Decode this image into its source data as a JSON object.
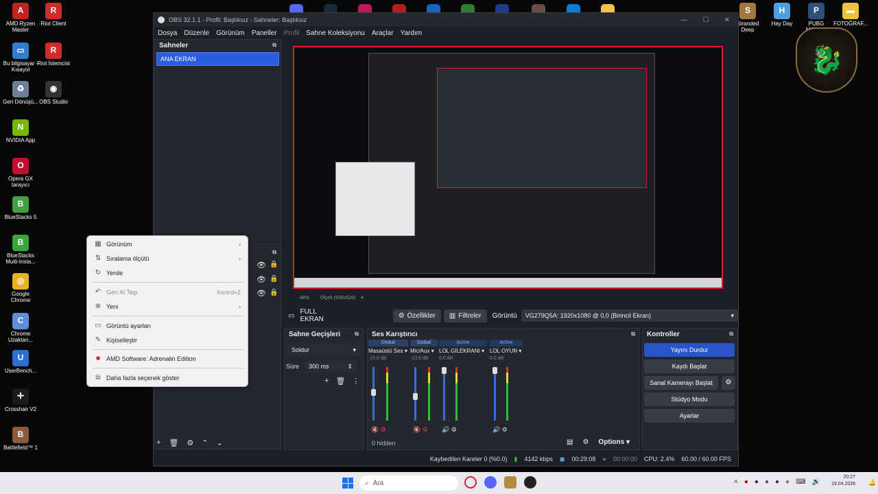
{
  "desktop": {
    "left_icons": [
      {
        "label": "AMD Ryzen Master",
        "color": "#c0241e",
        "glyph": "A"
      },
      {
        "label": "Riot Client",
        "color": "#d32a2a",
        "glyph": "R"
      },
      {
        "label": "Bu bilgisayar - Kısayol",
        "color": "#2f7dd1",
        "glyph": "▭"
      },
      {
        "label": "Riot İstemcisi",
        "color": "#d32a2a",
        "glyph": "R"
      },
      {
        "label": "Geri Dönüşü...",
        "color": "#6c7f96",
        "glyph": "♻"
      },
      {
        "label": "OBS Studio",
        "color": "#333",
        "glyph": "◉"
      },
      {
        "label": "NVIDIA App",
        "color": "#76b900",
        "glyph": "N"
      },
      {
        "label": "Opera GX tarayıcı",
        "color": "#c0102d",
        "glyph": "O"
      },
      {
        "label": "BlueStacks 5",
        "color": "#44a142",
        "glyph": "B"
      },
      {
        "label": "BlueStacks Multi-Insta...",
        "color": "#3aa53a",
        "glyph": "B"
      },
      {
        "label": "Google Chrome",
        "color": "#e8b321",
        "glyph": "◎"
      },
      {
        "label": "Chrome Uzaktan...",
        "color": "#5f8fd6",
        "glyph": "C"
      },
      {
        "label": "UserBench...",
        "color": "#2b6fd1",
        "glyph": "U"
      },
      {
        "label": "Crosshair V2",
        "color": "#1b1b1b",
        "glyph": "✛"
      },
      {
        "label": "Battlefield™ 1",
        "color": "#8d5a3c",
        "glyph": "B"
      }
    ],
    "right_icons": [
      {
        "label": "Stranded Deep",
        "color": "#a17840",
        "glyph": "S"
      },
      {
        "label": "Hay Day",
        "color": "#4aa0e0",
        "glyph": "H"
      },
      {
        "label": "PUBG MOBILE",
        "color": "#2f4f7a",
        "glyph": "P"
      },
      {
        "label": "FOTOĞRAF...",
        "color": "#f0c040",
        "glyph": "▬"
      }
    ],
    "msi_logo": "dragon"
  },
  "obs": {
    "title": "OBS 32.1.1 - Profil: Başlıksız - Sahneler: Başlıksız",
    "menu": [
      "Dosya",
      "Düzenle",
      "Görünüm",
      "Paneller",
      "Profil",
      "Sahne Koleksiyonu",
      "Araçlar",
      "Yardım"
    ],
    "scenes_title": "Sahneler",
    "scenes": [
      "ANA EKRAN"
    ],
    "preview_zoom": "48%",
    "preview_scale": "Ölçek (939x528)",
    "source_name": "FULL EKRAN",
    "properties_label": "Özellikler",
    "filters_label": "Filtreler",
    "display_label": "Görüntü",
    "display_value": "VG279Q5A: 1920x1080 @ 0,0 (Birincil Ekran)",
    "transitions": {
      "title": "Sahne Geçişleri",
      "value": "Soldur",
      "duration_label": "Süre",
      "duration": "300 ms"
    },
    "mixer": {
      "title": "Ses Karıştırıcı",
      "channels": [
        {
          "badge": "Global",
          "name": "Masaüstü Ses",
          "db": "-15.0 dB"
        },
        {
          "badge": "Global",
          "name": "Mic/Aux",
          "db": "-23.5 dB"
        },
        {
          "badge": "Active",
          "name": "LOL GİLEKRANI",
          "db": "0.0 dB"
        },
        {
          "badge": "Active",
          "name": "LOL OYUN",
          "db": "0.0 dB"
        }
      ],
      "hidden": "0 hidden",
      "options": "Options"
    },
    "controls": {
      "title": "Kontroller",
      "buttons": [
        "Yayını Durdur",
        "Kaydı Başlat",
        "Sanal Kamerayı Başlat",
        "Stüdyo Modu",
        "Ayarlar"
      ]
    },
    "status": {
      "dropped": "Kaybedilen Kareler 0 (%0.0)",
      "bitrate": "4142 kbps",
      "stream_time": "00:29:08",
      "rec_time": "00:00:00",
      "cpu": "CPU: 2.4%",
      "fps": "60.00 / 60.00 FPS"
    }
  },
  "context_menu": {
    "items": [
      {
        "label": "Görünüm",
        "icon": "▦",
        "submenu": true
      },
      {
        "label": "Sıralama ölçütü",
        "icon": "⇅",
        "submenu": true
      },
      {
        "label": "Yenile",
        "icon": "↻",
        "submenu": false
      },
      {
        "label": "Geri Al Taşı",
        "icon": "↶",
        "shortcut": "Kontrol+Z",
        "dim": true
      },
      {
        "label": "Yeni",
        "icon": "⊕",
        "submenu": true
      },
      {
        "label": "Görüntü ayarları",
        "icon": "▭"
      },
      {
        "label": "Kişiselleştir",
        "icon": "✎"
      },
      {
        "label": "AMD Software: Adrenalin Edition",
        "icon": "■"
      },
      {
        "label": "Daha fazla seçenek göster",
        "icon": "⧉"
      }
    ]
  },
  "taskbar": {
    "search_placeholder": "Ara",
    "time": "20:27",
    "date": "19.04.2026"
  }
}
